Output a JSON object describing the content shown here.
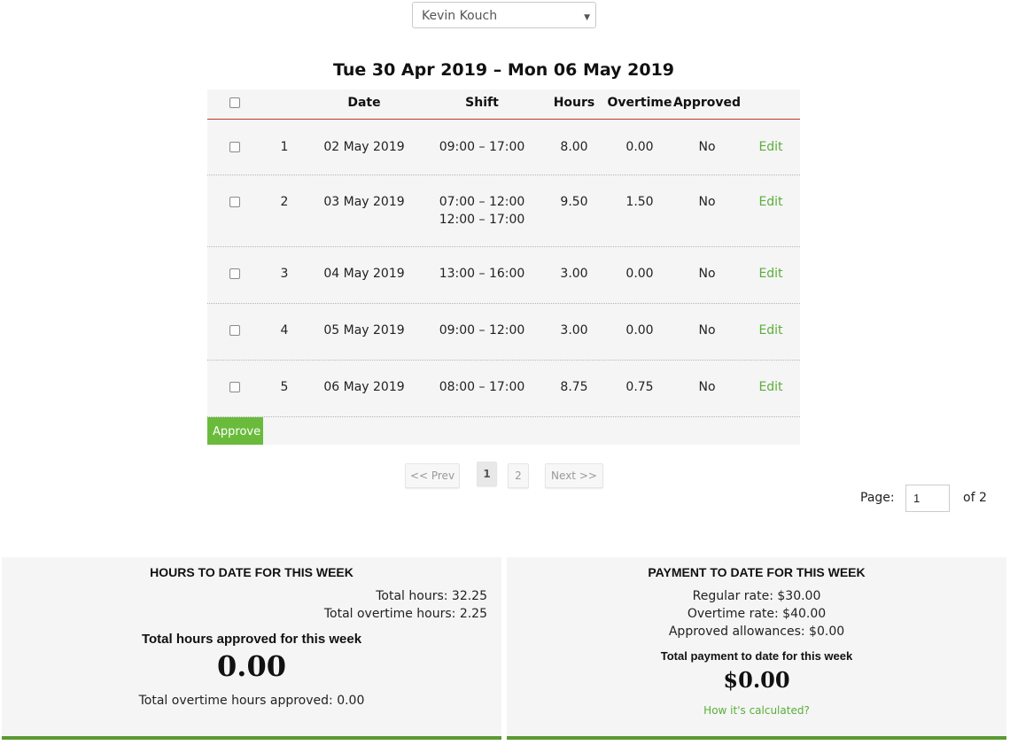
{
  "employee_select": {
    "value": "Kevin Kouch"
  },
  "week_title": "Tue 30 Apr 2019 – Mon 06 May 2019",
  "table": {
    "headers": {
      "date": "Date",
      "shift": "Shift",
      "hours": "Hours",
      "overtime": "Overtime",
      "approved": "Approved"
    },
    "rows": [
      {
        "num": "1",
        "date": "02 May 2019",
        "shifts": [
          "09:00 – 17:00"
        ],
        "hours": "8.00",
        "overtime": "0.00",
        "approved": "No",
        "edit": "Edit"
      },
      {
        "num": "2",
        "date": "03 May 2019",
        "shifts": [
          "07:00 – 12:00",
          "12:00 – 17:00"
        ],
        "hours": "9.50",
        "overtime": "1.50",
        "approved": "No",
        "edit": "Edit"
      },
      {
        "num": "3",
        "date": "04 May 2019",
        "shifts": [
          "13:00 – 16:00"
        ],
        "hours": "3.00",
        "overtime": "0.00",
        "approved": "No",
        "edit": "Edit"
      },
      {
        "num": "4",
        "date": "05 May 2019",
        "shifts": [
          "09:00 – 12:00"
        ],
        "hours": "3.00",
        "overtime": "0.00",
        "approved": "No",
        "edit": "Edit"
      },
      {
        "num": "5",
        "date": "06 May 2019",
        "shifts": [
          "08:00 – 17:00"
        ],
        "hours": "8.75",
        "overtime": "0.75",
        "approved": "No",
        "edit": "Edit"
      }
    ],
    "approve_label": "Approve"
  },
  "pagination": {
    "prev": "<< Prev",
    "pages": [
      "1",
      "2"
    ],
    "next": "Next >>",
    "page_label": "Page:",
    "page_value": "1",
    "of_label": "of 2"
  },
  "hours_panel": {
    "title": "HOURS TO DATE FOR THIS WEEK",
    "total_hours": "Total hours: 32.25",
    "total_overtime": "Total overtime hours: 2.25",
    "approved_heading": "Total hours approved for this week",
    "approved_value": "0.00",
    "overtime_approved": "Total overtime hours approved: 0.00"
  },
  "payment_panel": {
    "title": "PAYMENT TO DATE FOR THIS WEEK",
    "regular_rate": "Regular rate: $30.00",
    "overtime_rate": "Overtime rate: $40.00",
    "allowances": "Approved allowances: $0.00",
    "total_heading": "Total payment to date for this week",
    "total_value": "$0.00",
    "how_link": "How it's calculated?"
  },
  "colors": {
    "accent_green": "#6abb3c",
    "link_green": "#5aae3a",
    "header_rule": "#c0392b",
    "panel_border": "#5a9a32"
  }
}
